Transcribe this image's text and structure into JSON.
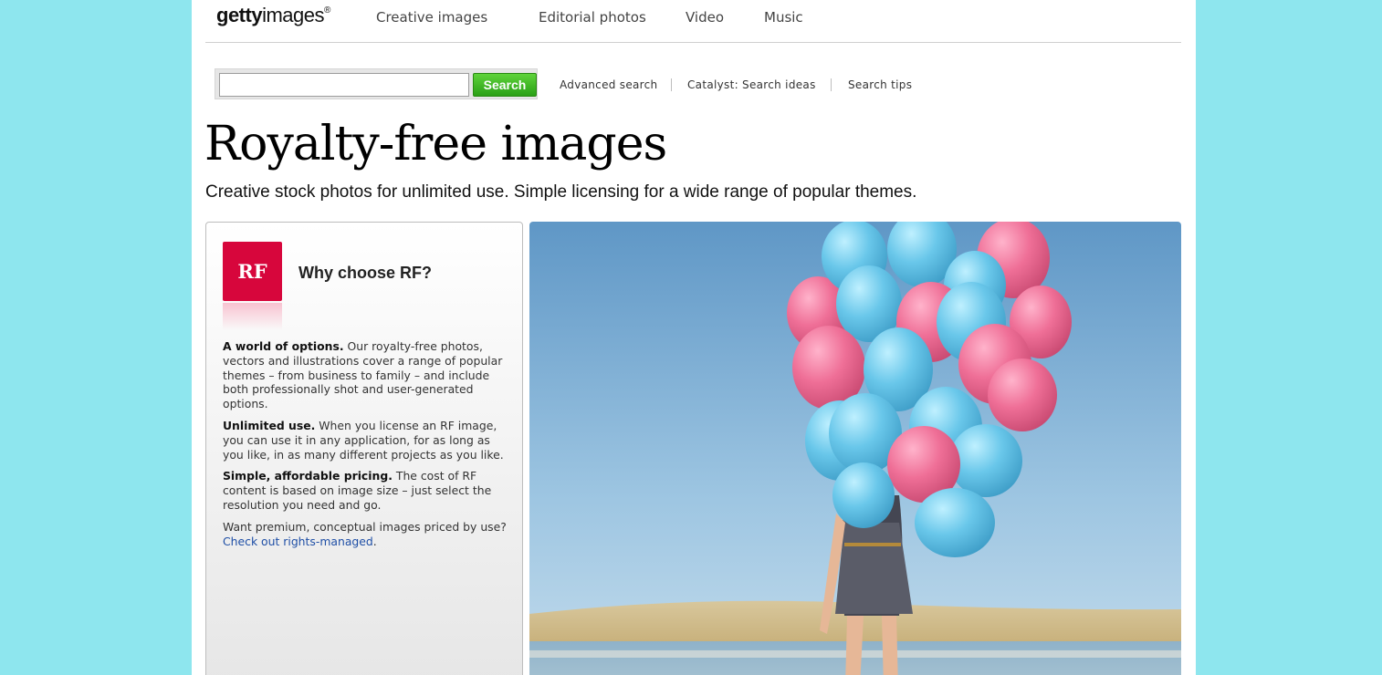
{
  "header": {
    "logo": {
      "bold": "getty",
      "light": "images",
      "mark": "®"
    },
    "nav": [
      {
        "label": "Creative images"
      },
      {
        "label": "Editorial photos"
      },
      {
        "label": "Video"
      },
      {
        "label": "Music"
      }
    ]
  },
  "search": {
    "value": "",
    "button_label": "Search",
    "links": [
      {
        "label": "Advanced search"
      },
      {
        "label": "Catalyst: Search ideas"
      },
      {
        "label": "Search tips"
      }
    ]
  },
  "main": {
    "title": "Royalty-free images",
    "subtitle": "Creative stock photos for unlimited use. Simple licensing for a wide range of popular themes."
  },
  "info_panel": {
    "badge": "RF",
    "heading": "Why choose RF?",
    "p1_bold": "A world of options.",
    "p1_text": " Our royalty-free photos, vectors and illustrations cover a range of popular themes – from business to family – and include both professionally shot and user-generated options.",
    "p2_bold": "Unlimited use.",
    "p2_text": " When you license an RF image, you can use it in any application, for as long as you like, in as many different projects as you like.",
    "p3_bold": "Simple, affordable pricing.",
    "p3_text": " The cost of RF content is based on image size – just select the resolution you need and go.",
    "p4_text": "Want premium, conceptual images priced by use? ",
    "p4_link": "Check out rights-managed",
    "p4_end": ".",
    "badge_color": "#d7063c"
  },
  "colors": {
    "background": "#8ee6ee",
    "search_button": "#3cb521",
    "link": "#1f4fa6"
  }
}
